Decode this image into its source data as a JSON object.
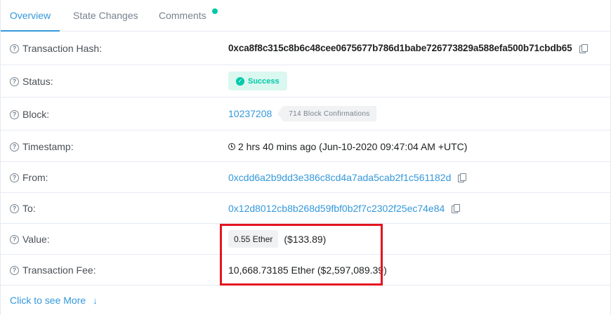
{
  "tabs": [
    {
      "label": "Overview",
      "active": true
    },
    {
      "label": "State Changes",
      "active": false
    },
    {
      "label": "Comments",
      "active": false
    }
  ],
  "rows": {
    "tx_hash": {
      "label": "Transaction Hash:",
      "value": "0xca8f8c315c8b6c48cee0675677b786d1babe726773829a588efa500b71cbdb65"
    },
    "status": {
      "label": "Status:",
      "value": "Success"
    },
    "block": {
      "label": "Block:",
      "value": "10237208",
      "confirmations": "714 Block Confirmations"
    },
    "timestamp": {
      "label": "Timestamp:",
      "value": "2 hrs 40 mins ago (Jun-10-2020 09:47:04 AM +UTC)"
    },
    "from": {
      "label": "From:",
      "value": "0xcdd6a2b9dd3e386c8cd4a7ada5cab2f1c561182d"
    },
    "to": {
      "label": "To:",
      "value": "0x12d8012cb8b268d59fbf0b2f7c2302f25ec74e84"
    },
    "value": {
      "label": "Value:",
      "ether": "0.55 Ether",
      "usd": "($133.89)"
    },
    "fee": {
      "label": "Transaction Fee:",
      "value": "10,668.73185 Ether ($2,597,089.39)"
    }
  },
  "see_more": "Click to see More",
  "icons": {
    "help": "question-circle-icon",
    "copy": "copy-icon",
    "clock": "clock-icon",
    "check": "check-circle-icon",
    "arrow": "arrow-down-icon"
  },
  "colors": {
    "accent": "#3498db",
    "success": "#00c9a7",
    "highlight": "#e3151f"
  }
}
